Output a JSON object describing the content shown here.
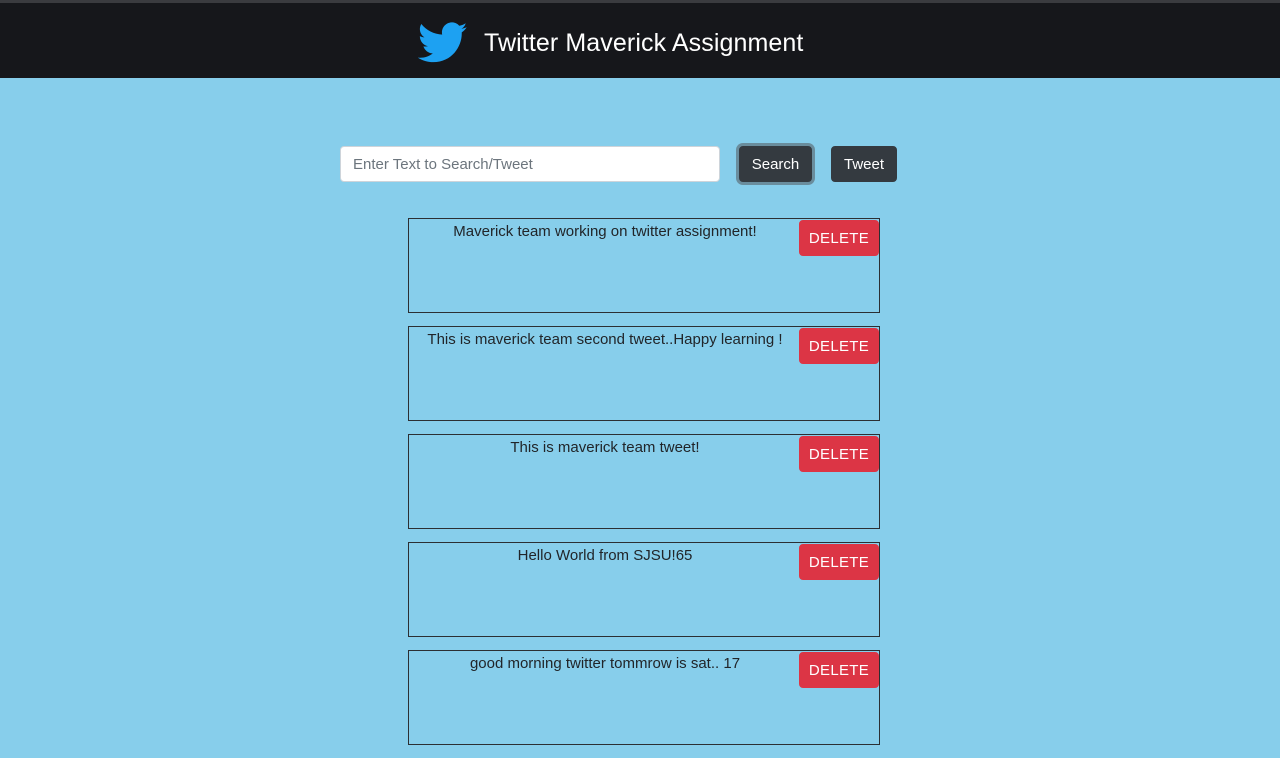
{
  "header": {
    "logo_icon": "twitter-bird-icon",
    "logo_color": "#1da1f2",
    "title": "Twitter Maverick Assignment"
  },
  "search": {
    "placeholder": "Enter Text to Search/Tweet",
    "value": ""
  },
  "buttons": {
    "search_label": "Search",
    "tweet_label": "Tweet"
  },
  "tweets": [
    {
      "text": "Maverick team working on twitter assignment!",
      "delete_label": "DELETE"
    },
    {
      "text": "This is maverick team second tweet..Happy learning !",
      "delete_label": "DELETE"
    },
    {
      "text": "This is maverick team tweet!",
      "delete_label": "DELETE"
    },
    {
      "text": "Hello World from SJSU!65",
      "delete_label": "DELETE"
    },
    {
      "text": "good morning twitter tommrow is sat.. 17",
      "delete_label": "DELETE"
    }
  ],
  "colors": {
    "page_background": "#87ceeb",
    "header_background": "#16171b",
    "dark_button": "#343a40",
    "delete_button": "#dc3545"
  }
}
